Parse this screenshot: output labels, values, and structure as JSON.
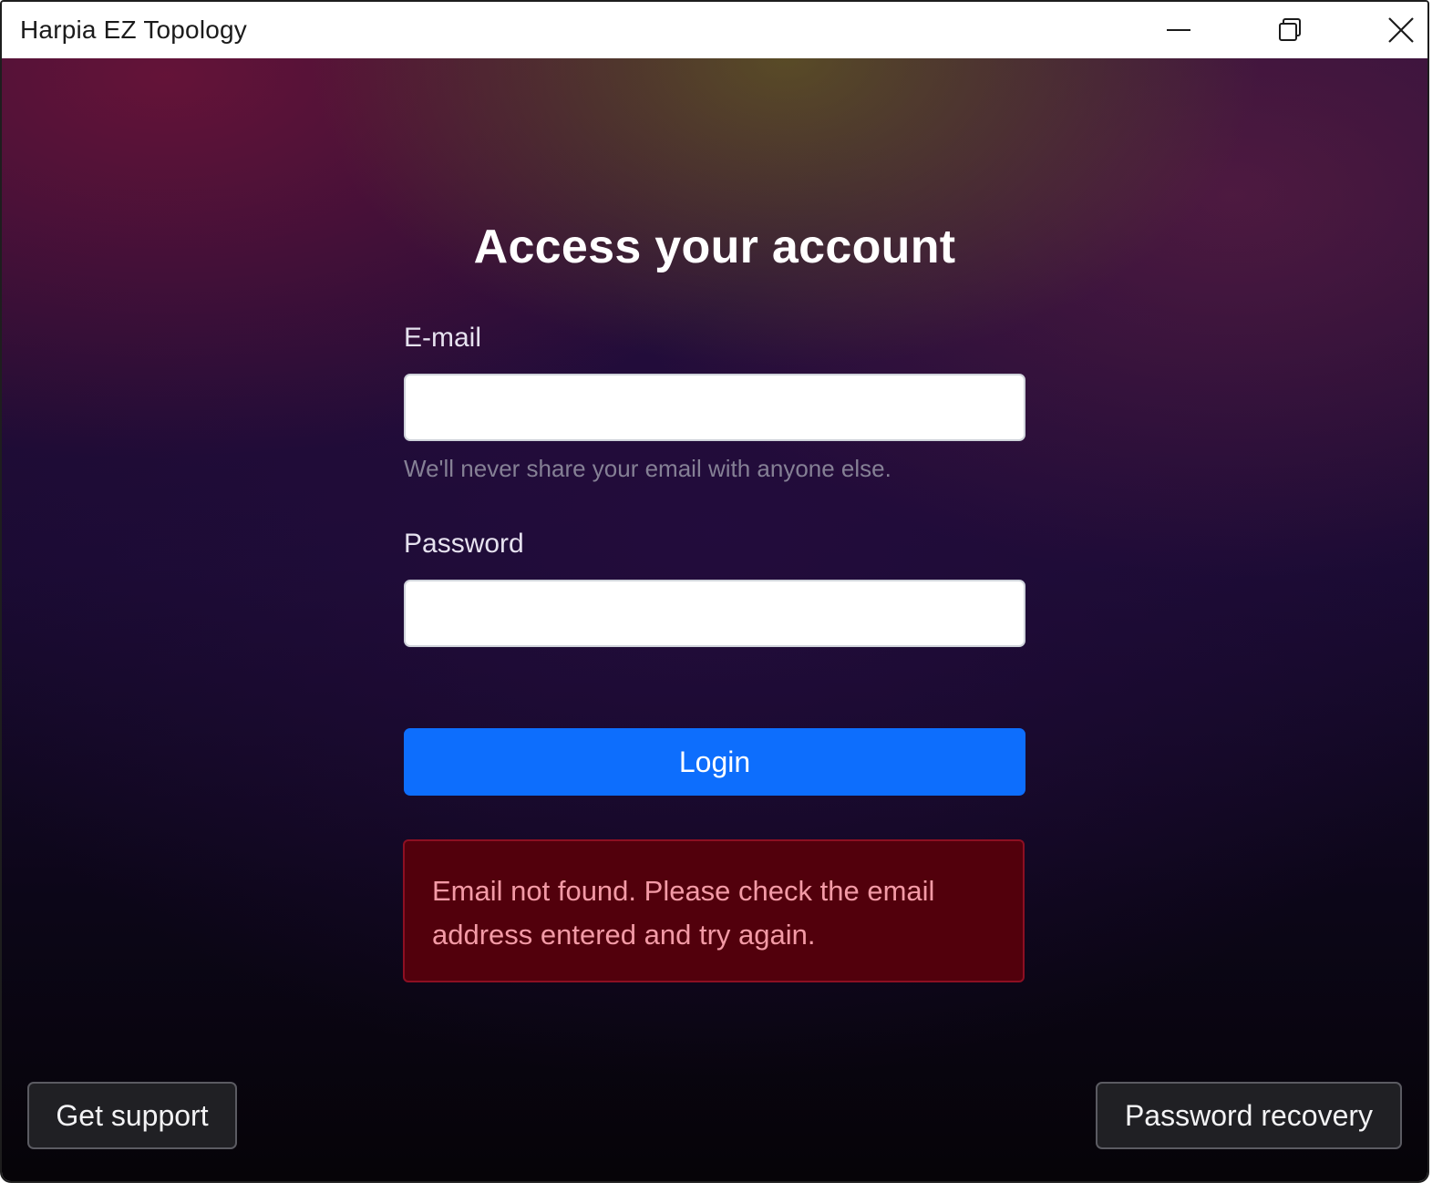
{
  "window": {
    "title": "Harpia EZ Topology"
  },
  "login": {
    "heading": "Access your account",
    "email_label": "E-mail",
    "email_value": "",
    "email_help": "We'll never share your email with anyone else.",
    "password_label": "Password",
    "password_value": "",
    "login_button": "Login",
    "error_message": "Email not found. Please check the email address entered and try again."
  },
  "footer": {
    "support_button": "Get support",
    "recovery_button": "Password recovery"
  },
  "colors": {
    "primary": "#0d6efd",
    "error_background": "#52000c",
    "error_text": "#f39aa6"
  },
  "icons": {
    "minimize": "minimize-icon",
    "maximize": "restore-icon",
    "close": "close-icon"
  }
}
